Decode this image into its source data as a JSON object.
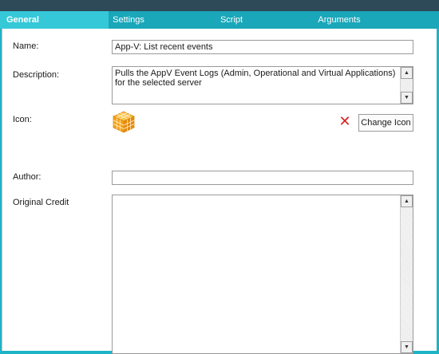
{
  "tabs": [
    {
      "label": "General",
      "active": true
    },
    {
      "label": "Settings",
      "active": false
    },
    {
      "label": "Script",
      "active": false
    },
    {
      "label": "Arguments",
      "active": false
    }
  ],
  "form": {
    "name_label": "Name:",
    "name_value": "App-V: List recent events",
    "description_label": "Description:",
    "description_value": "Pulls the AppV Event Logs (Admin, Operational and Virtual Applications) for the selected server",
    "icon_label": "Icon:",
    "delete_icon": "red-x-icon",
    "change_icon_label": "Change Icon",
    "author_label": "Author:",
    "author_value": "",
    "original_credit_label": "Original Credit",
    "original_credit_value": ""
  },
  "colors": {
    "tab_bar": "#1aa7b9",
    "active_tab": "#35c8d8",
    "title_bar": "#2e4a58",
    "delete": "#d42121",
    "icon": "#f5a21b"
  }
}
